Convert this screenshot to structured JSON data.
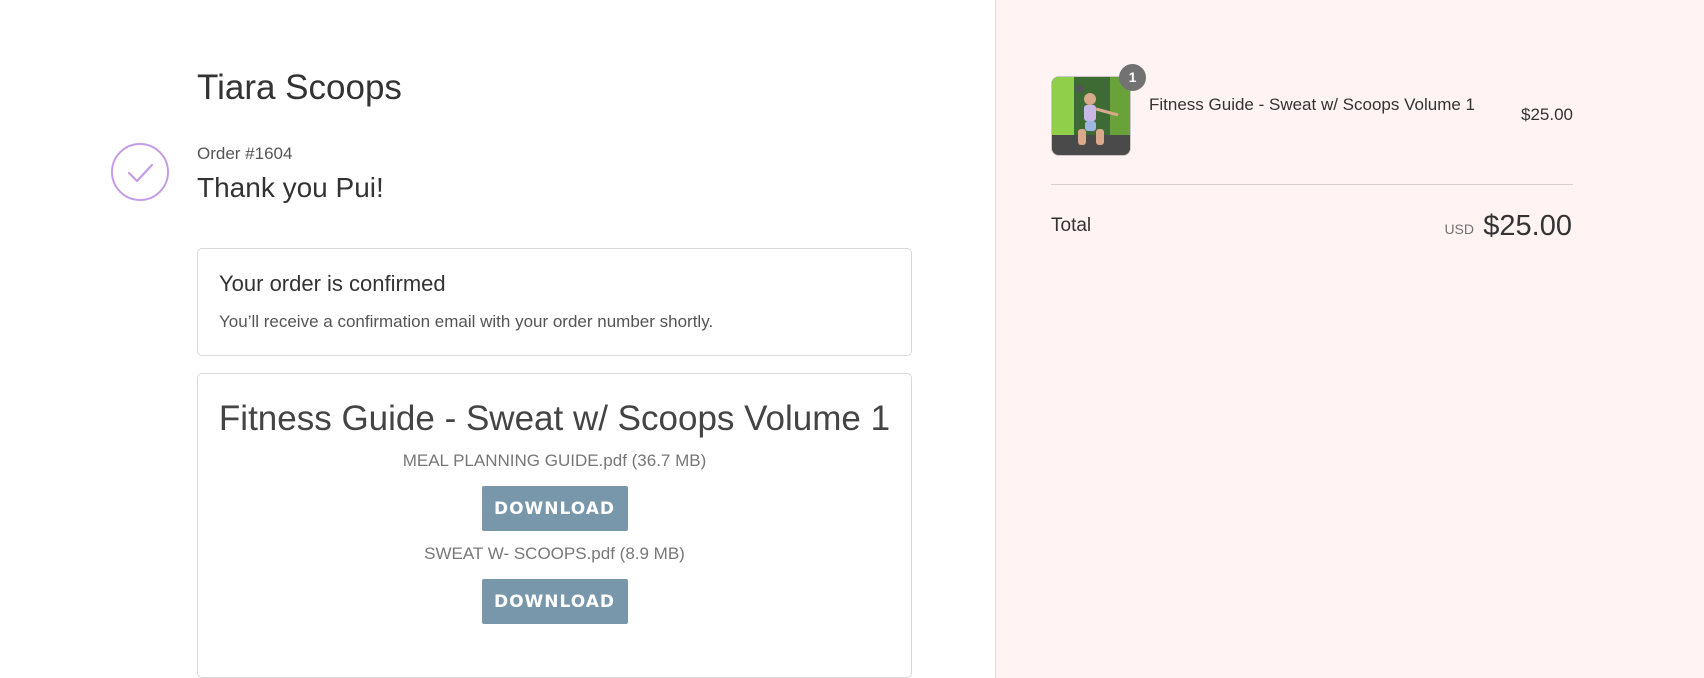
{
  "header": {
    "store_name": "Tiara Scoops",
    "order_number": "Order #1604",
    "thank_you": "Thank you Pui!"
  },
  "confirmation": {
    "title": "Your order is confirmed",
    "message": "You’ll receive a confirmation email with your order number shortly."
  },
  "downloads": {
    "product_title": "Fitness Guide - Sweat w/ Scoops Volume 1",
    "files": [
      {
        "name": "MEAL PLANNING GUIDE.pdf (36.7 MB)",
        "button_label": "DOWNLOAD"
      },
      {
        "name": "SWEAT W- SCOOPS.pdf (8.9 MB)",
        "button_label": "DOWNLOAD"
      }
    ]
  },
  "summary": {
    "item": {
      "quantity": "1",
      "name": "Fitness Guide - Sweat w/ Scoops Volume 1",
      "price": "$25.00"
    },
    "total_label": "Total",
    "currency": "USD",
    "total_amount": "$25.00"
  },
  "colors": {
    "accent": "#c59ce8",
    "button": "#7897aa",
    "sidebar_bg": "#fff3f3"
  },
  "icons": {
    "check": "checkmark-icon"
  }
}
